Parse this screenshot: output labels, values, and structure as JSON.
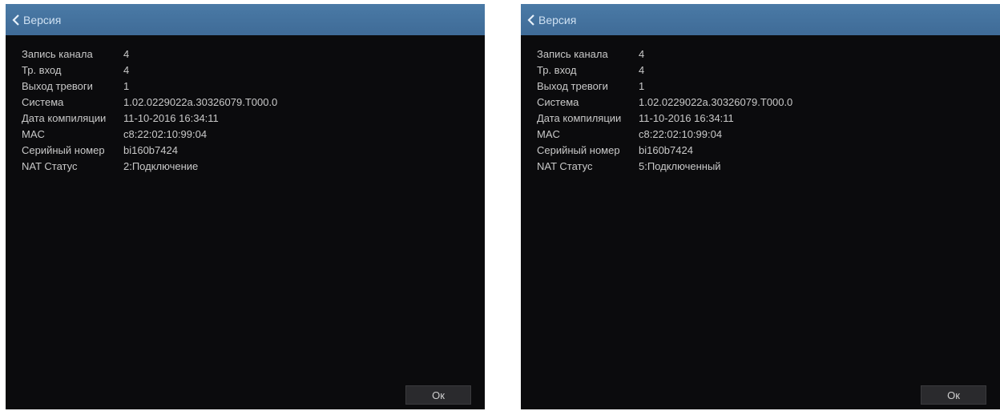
{
  "panels": [
    {
      "title": "Версия",
      "rows": [
        {
          "label": "Запись канала",
          "value": "4"
        },
        {
          "label": "Тр. вход",
          "value": "4"
        },
        {
          "label": "Выход тревоги",
          "value": "1"
        },
        {
          "label": "Система",
          "value": "1.02.0229022a.30326079.T000.0"
        },
        {
          "label": "Дата компиляции",
          "value": "11-10-2016 16:34:11"
        },
        {
          "label": "MAC",
          "value": "c8:22:02:10:99:04"
        },
        {
          "label": "Серийный номер",
          "value": "bi160b7424"
        },
        {
          "label": "NAT Статус",
          "value": "2:Подключение"
        }
      ],
      "ok_label": "Ок"
    },
    {
      "title": "Версия",
      "rows": [
        {
          "label": "Запись канала",
          "value": "4"
        },
        {
          "label": "Тр. вход",
          "value": "4"
        },
        {
          "label": "Выход тревоги",
          "value": "1"
        },
        {
          "label": "Система",
          "value": "1.02.0229022a.30326079.T000.0"
        },
        {
          "label": "Дата компиляции",
          "value": "11-10-2016 16:34:11"
        },
        {
          "label": "MAC",
          "value": "c8:22:02:10:99:04"
        },
        {
          "label": "Серийный номер",
          "value": "bi160b7424"
        },
        {
          "label": "NAT Статус",
          "value": "5:Подключенный"
        }
      ],
      "ok_label": "Ок"
    }
  ],
  "colors": {
    "titlebar": "#3f6b97",
    "background": "#0b0b0d",
    "text": "#c9c9c9"
  }
}
